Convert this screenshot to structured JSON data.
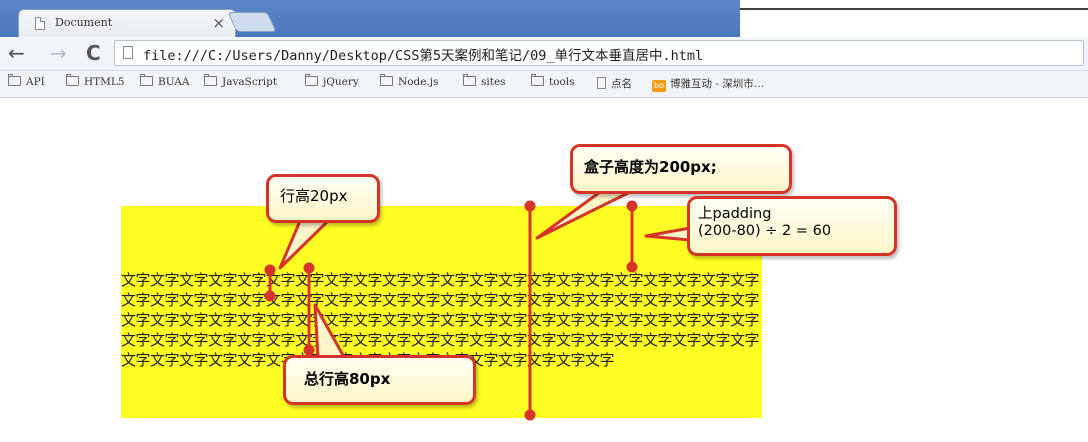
{
  "tab": {
    "title": "Document",
    "close_glyph": "×"
  },
  "toolbar": {
    "back_icon": "←",
    "forward_icon": "→",
    "reload_icon": "C",
    "url": "file:///C:/Users/Danny/Desktop/CSS第5天案例和笔记/09_单行文本垂直居中.html"
  },
  "bookmarks": [
    {
      "label": "API",
      "icon": "folder-icon"
    },
    {
      "label": "HTML5",
      "icon": "folder-icon"
    },
    {
      "label": "BUAA",
      "icon": "folder-icon"
    },
    {
      "label": "JavaScript",
      "icon": "folder-icon"
    },
    {
      "label": "jQuery",
      "icon": "folder-icon"
    },
    {
      "label": "Node.js",
      "icon": "folder-icon"
    },
    {
      "label": "sites",
      "icon": "folder-icon"
    },
    {
      "label": "tools",
      "icon": "folder-icon"
    },
    {
      "label": "点名",
      "icon": "page-icon"
    },
    {
      "label": "博雅互动 - 深圳市…",
      "icon": "site-icon"
    }
  ],
  "page": {
    "box_color": "#ffff24",
    "text": "文字文字文字文字文字文字文字文字文字文字文字文字文字文字文字文字文字文字文字文字文字文字文字文字文字文字文字文字文字文字文字文字文字文字文字文字文字文字文字文字文字文字文字文字文字文字文字文字文字文字文字文字文字文字文字文字文字文字文字文字文字文字文字文字文字文字文字文字文字文字文字文字文字文字文字文字文字文字文字文字文字文字文字文字文字文字文字文字文字文字文字文字文字文字文字文字文字文字文字文字文字文字文字文字文字"
  },
  "annotations": {
    "line_height_label": "行高20px",
    "box_height_label": "盒子高度为200px;",
    "padding_label_line1": "上padding",
    "padding_label_line2": "(200-80) ÷ 2 = 60",
    "total_height_label": "总行高80px",
    "accent_color": "#d63428"
  }
}
